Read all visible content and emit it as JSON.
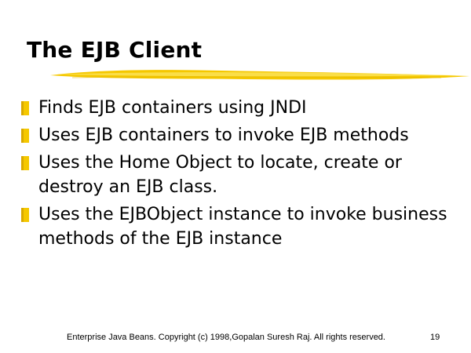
{
  "slide": {
    "title": "The EJB Client",
    "bullets": [
      "Finds EJB containers using JNDI",
      "Uses EJB containers to invoke EJB methods",
      "Uses the Home Object to locate, create or destroy an EJB class.",
      "Uses the EJBObject instance to invoke business methods of the EJB instance"
    ],
    "footer": "Enterprise Java Beans. Copyright (c) 1998,Gopalan Suresh Raj. All rights reserved.",
    "page_number": "19"
  },
  "colors": {
    "accent": "#f5c800",
    "text": "#000000",
    "background": "#ffffff"
  },
  "icons": {
    "bullet": "yellow-square-bullet-icon",
    "underline": "brush-stroke-underline"
  }
}
